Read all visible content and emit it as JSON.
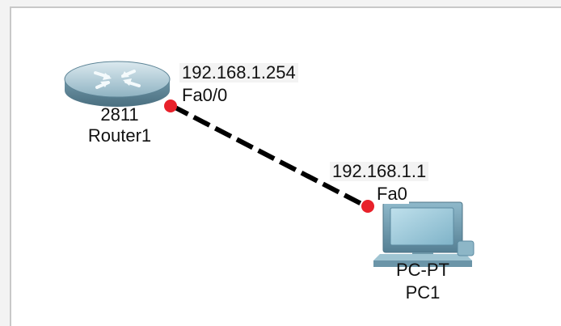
{
  "topology": {
    "router": {
      "model": "2811",
      "name": "Router1",
      "interface": "Fa0/0",
      "ip": "192.168.1.254",
      "icon": "router-icon"
    },
    "pc": {
      "model": "PC-PT",
      "name": "PC1",
      "interface": "Fa0",
      "ip": "192.168.1.1",
      "icon": "pc-icon"
    },
    "link": {
      "style": "dashed",
      "color": "#000000",
      "endpoint_color": "#e8212a"
    }
  }
}
